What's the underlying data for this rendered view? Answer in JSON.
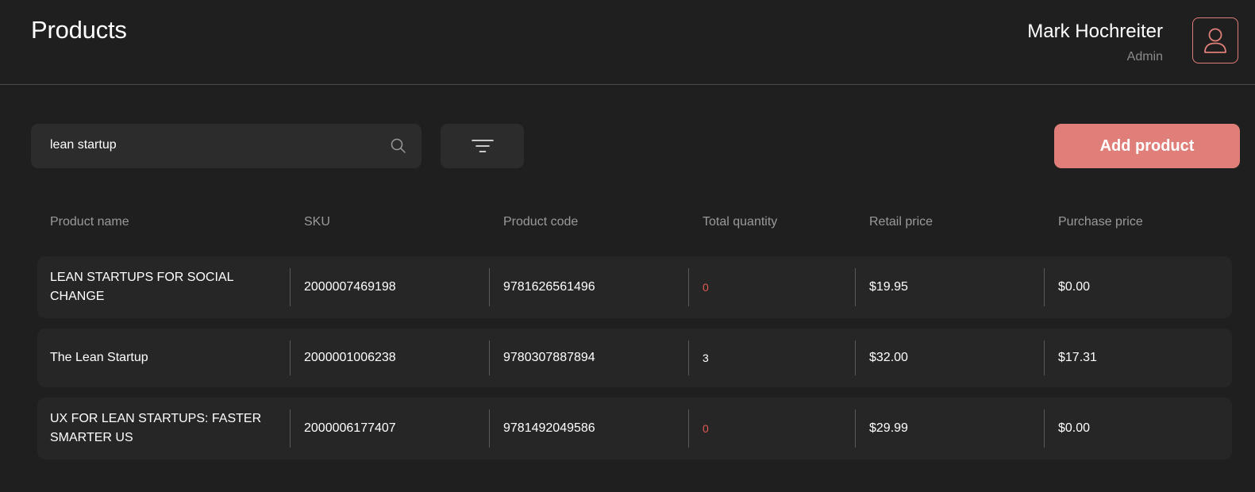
{
  "header": {
    "title": "Products",
    "user_name": "Mark Hochreiter",
    "user_role": "Admin"
  },
  "toolbar": {
    "search_value": "lean startup",
    "add_label": "Add product"
  },
  "table": {
    "columns": [
      "Product name",
      "SKU",
      "Product code",
      "Total quantity",
      "Retail price",
      "Purchase price"
    ],
    "rows": [
      {
        "name": "LEAN STARTUPS FOR SOCIAL CHANGE",
        "sku": "2000007469198",
        "code": "9781626561496",
        "quantity": "0",
        "retail": "$19.95",
        "purchase": "$0.00"
      },
      {
        "name": "The Lean Startup",
        "sku": "2000001006238",
        "code": "9780307887894",
        "quantity": "3",
        "retail": "$32.00",
        "purchase": "$17.31"
      },
      {
        "name": "UX FOR LEAN STARTUPS: FASTER SMARTER US",
        "sku": "2000006177407",
        "code": "9781492049586",
        "quantity": "0",
        "retail": "$29.99",
        "purchase": "$0.00"
      }
    ]
  },
  "colors": {
    "accent": "#e07f79",
    "zero_quantity": "#e05a4f",
    "background": "#1f1f1f"
  },
  "icons": {
    "avatar": "user-icon",
    "search": "search-icon",
    "filter": "filter-icon"
  }
}
